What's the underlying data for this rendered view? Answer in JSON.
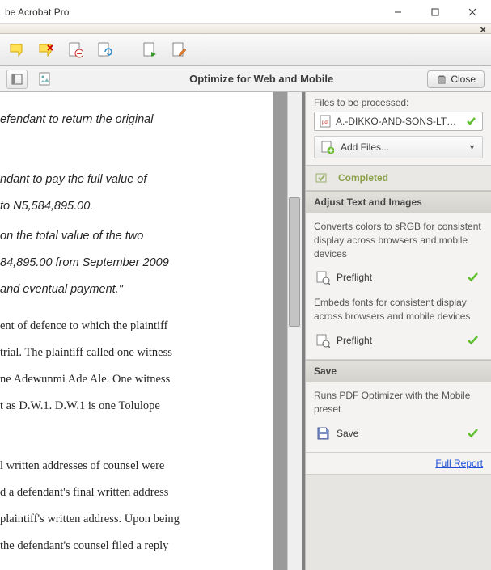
{
  "window": {
    "title": "be Acrobat Pro",
    "close_x": "×"
  },
  "subbar": {
    "panel_title": "Optimize for Web and Mobile",
    "close_label": "Close"
  },
  "document": {
    "p1": "efendant   to   return   the   original",
    "p2": "ndant   to   pay   the   full   value   of",
    "p3": "to  N5,584,895.00.",
    "p4": " on  the  total  value  of  the  two",
    "p5": "84,895.00   from   September   2009",
    "p6": " and  eventual  payment.\"",
    "p7": "ent  of  defence  to  which  the  plaintiff",
    "p8": " trial.  The  plaintiff  called  one  witness",
    "p9": "ne  Adewunmi  Ade  Ale.  One  witness",
    "p10": "t   as   D.W.1.   D.W.1   is   one   Tolulope",
    "p11": "l   written   addresses   of   counsel   were",
    "p12": "d  a  defendant's  final  written  address",
    "p13": " plaintiff's  written  address.  Upon  being",
    "p14": "the  defendant's  counsel  filed  a  reply"
  },
  "sidepanel": {
    "files_label": "Files to be processed:",
    "file_name": "A.-DIKKO-AND-SONS-LTD...",
    "add_files": "Add Files...",
    "completed": "Completed",
    "adjust_header": "Adjust Text and Images",
    "adjust_desc1": "Converts colors to sRGB for consistent display across browsers and mobile devices",
    "adjust_action1": "Preflight",
    "adjust_desc2": "Embeds fonts for consistent display across browsers and mobile devices",
    "adjust_action2": "Preflight",
    "save_header": "Save",
    "save_desc": "Runs PDF Optimizer with the Mobile preset",
    "save_action": "Save",
    "full_report": "Full Report"
  }
}
